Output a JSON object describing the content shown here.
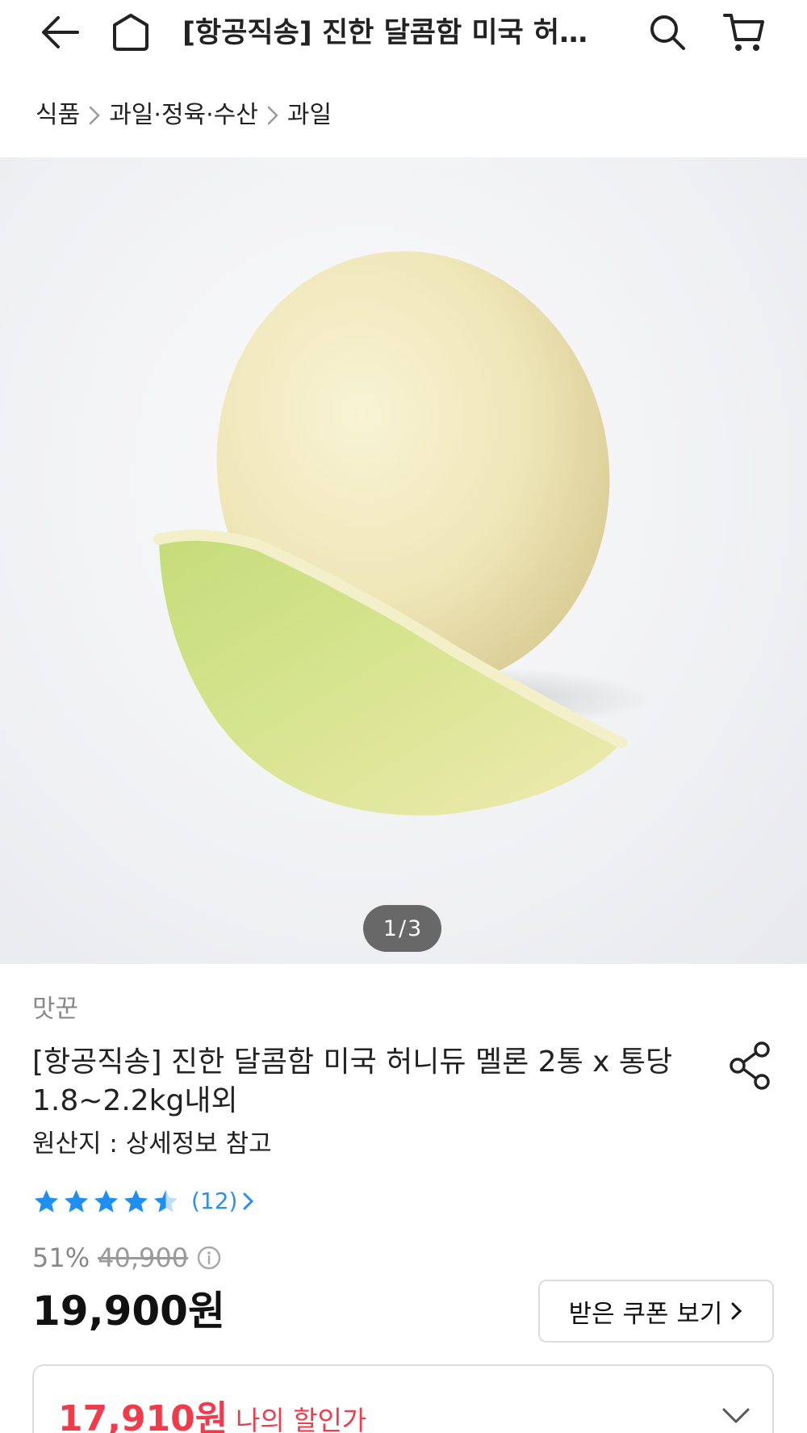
{
  "header": {
    "title": "[항공직송] 진한 달콤함 미국 허니...",
    "back_icon": "arrow-left-icon",
    "home_icon": "home-icon",
    "search_icon": "search-icon",
    "cart_icon": "cart-icon"
  },
  "breadcrumb": {
    "items": [
      "식품",
      "과일·정육·수산",
      "과일"
    ]
  },
  "gallery": {
    "current": "1",
    "separator": "/",
    "total": "3"
  },
  "product": {
    "seller": "맛꾼",
    "name": "[항공직송] 진한 달콤함 미국 허니듀 멜론 2통 x 통당 1.8~2.2kg내외",
    "origin": "원산지 : 상세정보 참고",
    "rating": {
      "stars": 5,
      "stars_filled": 4.5,
      "review_count": "(12)",
      "star_color": "#1e8ff0"
    },
    "discount_rate": "51%",
    "original_price": "40,900",
    "price": "19,900원",
    "coupon_button": "받은 쿠폰 보기",
    "my_price": {
      "value": "17,910원",
      "label": "나의 할인가",
      "color": "#f03b4a"
    }
  },
  "colors": {
    "accent_blue": "#2a8ef4",
    "discount_red": "#f03b4a"
  }
}
